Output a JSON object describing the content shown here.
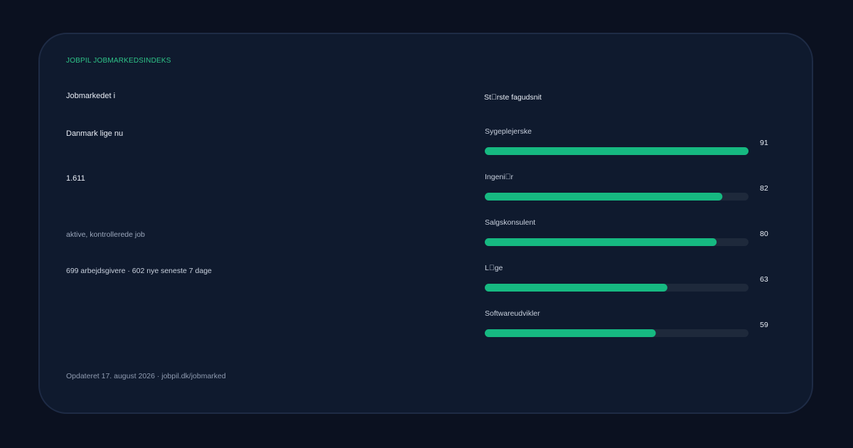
{
  "eyebrow": "JOBPIL JOBMARKEDSINDEKS",
  "headline": {
    "line1": "Jobmarkedet i",
    "line2": "Danmark lige nu"
  },
  "stat": {
    "value": "1.611",
    "label": "aktive, kontrollerede job",
    "meta": "699 arbejdsgivere · 602 nye seneste 7 dage"
  },
  "footer": "Opdateret 17. august 2026 · jobpil.dk/jobmarked",
  "colors": {
    "background": "#0b1120",
    "card": "#0f1a2e",
    "accent": "#16b981",
    "track": "#1e293b"
  },
  "chart_data": {
    "type": "bar",
    "orientation": "horizontal",
    "title": "St\u0000rste fagudsnit",
    "categories": [
      "Sygeplejerske",
      "Ingeni\u0000r",
      "Salgskonsulent",
      "L\u0000ge",
      "Softwareudvikler"
    ],
    "values": [
      91,
      82,
      80,
      63,
      59
    ],
    "xlim": [
      0,
      91
    ],
    "grid": false
  }
}
